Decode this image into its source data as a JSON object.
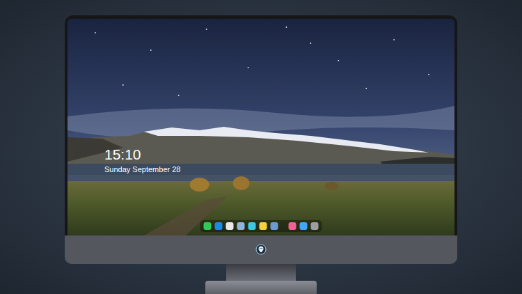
{
  "lock_screen": {
    "time": "15:10",
    "date": "Sunday September 28"
  },
  "dock": {
    "items": [
      {
        "color": "#34c759"
      },
      {
        "color": "#1e88e5"
      },
      {
        "color": "#e8e8e8"
      },
      {
        "color": "#8fb3d9"
      },
      {
        "color": "#3ec7e0"
      },
      {
        "color": "#f5d142"
      },
      {
        "color": "#6a9bd1"
      },
      {
        "color": "#f06292"
      },
      {
        "color": "#42a5f5"
      },
      {
        "color": "#9e9e9e"
      }
    ]
  }
}
